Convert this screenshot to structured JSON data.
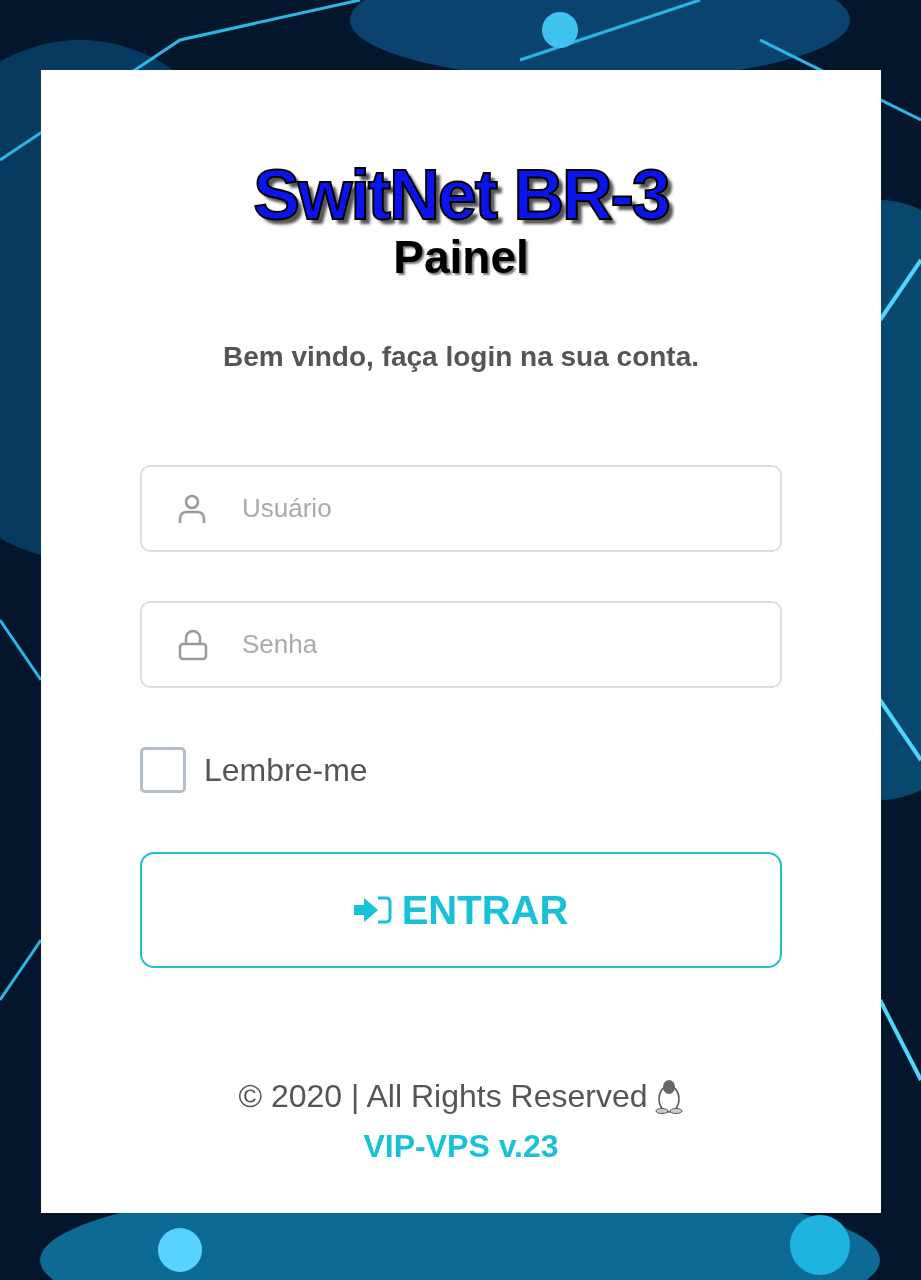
{
  "logo": {
    "title": "SwitNet BR-3",
    "subtitle": "Painel"
  },
  "welcome": "Bem vindo, faça login na sua conta.",
  "fields": [
    {
      "kind": "user",
      "placeholder": "Usuário"
    },
    {
      "kind": "password",
      "placeholder": "Senha"
    }
  ],
  "remember": {
    "label": "Lembre-me",
    "checked": false
  },
  "submit": {
    "label": "ENTRAR"
  },
  "footer": {
    "copyright": "© 2020 | All Rights Reserved",
    "version": "VIP-VPS v.23"
  }
}
